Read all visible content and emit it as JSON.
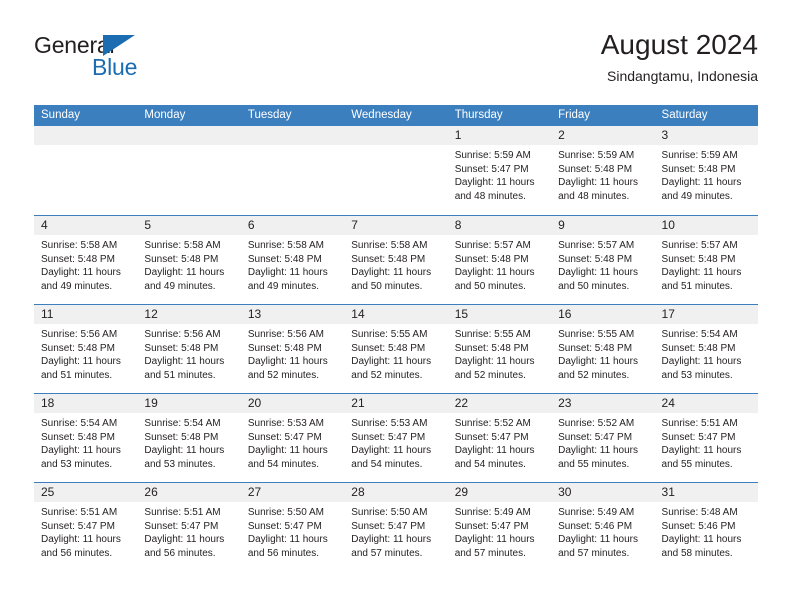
{
  "brand": {
    "name_top": "General",
    "name_bottom": "Blue",
    "accent_color": "#1b6cb0"
  },
  "header": {
    "title": "August 2024",
    "subtitle": "Sindangtamu, Indonesia"
  },
  "theme": {
    "header_row_bg": "#3c7fbf",
    "day_number_bg": "#f0f0f0",
    "text_color": "#231f20"
  },
  "weekdays": [
    "Sunday",
    "Monday",
    "Tuesday",
    "Wednesday",
    "Thursday",
    "Friday",
    "Saturday"
  ],
  "weeks": [
    [
      {
        "day": "",
        "lines": []
      },
      {
        "day": "",
        "lines": []
      },
      {
        "day": "",
        "lines": []
      },
      {
        "day": "",
        "lines": []
      },
      {
        "day": "1",
        "lines": [
          "Sunrise: 5:59 AM",
          "Sunset: 5:47 PM",
          "Daylight: 11 hours and 48 minutes."
        ]
      },
      {
        "day": "2",
        "lines": [
          "Sunrise: 5:59 AM",
          "Sunset: 5:48 PM",
          "Daylight: 11 hours and 48 minutes."
        ]
      },
      {
        "day": "3",
        "lines": [
          "Sunrise: 5:59 AM",
          "Sunset: 5:48 PM",
          "Daylight: 11 hours and 49 minutes."
        ]
      }
    ],
    [
      {
        "day": "4",
        "lines": [
          "Sunrise: 5:58 AM",
          "Sunset: 5:48 PM",
          "Daylight: 11 hours and 49 minutes."
        ]
      },
      {
        "day": "5",
        "lines": [
          "Sunrise: 5:58 AM",
          "Sunset: 5:48 PM",
          "Daylight: 11 hours and 49 minutes."
        ]
      },
      {
        "day": "6",
        "lines": [
          "Sunrise: 5:58 AM",
          "Sunset: 5:48 PM",
          "Daylight: 11 hours and 49 minutes."
        ]
      },
      {
        "day": "7",
        "lines": [
          "Sunrise: 5:58 AM",
          "Sunset: 5:48 PM",
          "Daylight: 11 hours and 50 minutes."
        ]
      },
      {
        "day": "8",
        "lines": [
          "Sunrise: 5:57 AM",
          "Sunset: 5:48 PM",
          "Daylight: 11 hours and 50 minutes."
        ]
      },
      {
        "day": "9",
        "lines": [
          "Sunrise: 5:57 AM",
          "Sunset: 5:48 PM",
          "Daylight: 11 hours and 50 minutes."
        ]
      },
      {
        "day": "10",
        "lines": [
          "Sunrise: 5:57 AM",
          "Sunset: 5:48 PM",
          "Daylight: 11 hours and 51 minutes."
        ]
      }
    ],
    [
      {
        "day": "11",
        "lines": [
          "Sunrise: 5:56 AM",
          "Sunset: 5:48 PM",
          "Daylight: 11 hours and 51 minutes."
        ]
      },
      {
        "day": "12",
        "lines": [
          "Sunrise: 5:56 AM",
          "Sunset: 5:48 PM",
          "Daylight: 11 hours and 51 minutes."
        ]
      },
      {
        "day": "13",
        "lines": [
          "Sunrise: 5:56 AM",
          "Sunset: 5:48 PM",
          "Daylight: 11 hours and 52 minutes."
        ]
      },
      {
        "day": "14",
        "lines": [
          "Sunrise: 5:55 AM",
          "Sunset: 5:48 PM",
          "Daylight: 11 hours and 52 minutes."
        ]
      },
      {
        "day": "15",
        "lines": [
          "Sunrise: 5:55 AM",
          "Sunset: 5:48 PM",
          "Daylight: 11 hours and 52 minutes."
        ]
      },
      {
        "day": "16",
        "lines": [
          "Sunrise: 5:55 AM",
          "Sunset: 5:48 PM",
          "Daylight: 11 hours and 52 minutes."
        ]
      },
      {
        "day": "17",
        "lines": [
          "Sunrise: 5:54 AM",
          "Sunset: 5:48 PM",
          "Daylight: 11 hours and 53 minutes."
        ]
      }
    ],
    [
      {
        "day": "18",
        "lines": [
          "Sunrise: 5:54 AM",
          "Sunset: 5:48 PM",
          "Daylight: 11 hours and 53 minutes."
        ]
      },
      {
        "day": "19",
        "lines": [
          "Sunrise: 5:54 AM",
          "Sunset: 5:48 PM",
          "Daylight: 11 hours and 53 minutes."
        ]
      },
      {
        "day": "20",
        "lines": [
          "Sunrise: 5:53 AM",
          "Sunset: 5:47 PM",
          "Daylight: 11 hours and 54 minutes."
        ]
      },
      {
        "day": "21",
        "lines": [
          "Sunrise: 5:53 AM",
          "Sunset: 5:47 PM",
          "Daylight: 11 hours and 54 minutes."
        ]
      },
      {
        "day": "22",
        "lines": [
          "Sunrise: 5:52 AM",
          "Sunset: 5:47 PM",
          "Daylight: 11 hours and 54 minutes."
        ]
      },
      {
        "day": "23",
        "lines": [
          "Sunrise: 5:52 AM",
          "Sunset: 5:47 PM",
          "Daylight: 11 hours and 55 minutes."
        ]
      },
      {
        "day": "24",
        "lines": [
          "Sunrise: 5:51 AM",
          "Sunset: 5:47 PM",
          "Daylight: 11 hours and 55 minutes."
        ]
      }
    ],
    [
      {
        "day": "25",
        "lines": [
          "Sunrise: 5:51 AM",
          "Sunset: 5:47 PM",
          "Daylight: 11 hours and 56 minutes."
        ]
      },
      {
        "day": "26",
        "lines": [
          "Sunrise: 5:51 AM",
          "Sunset: 5:47 PM",
          "Daylight: 11 hours and 56 minutes."
        ]
      },
      {
        "day": "27",
        "lines": [
          "Sunrise: 5:50 AM",
          "Sunset: 5:47 PM",
          "Daylight: 11 hours and 56 minutes."
        ]
      },
      {
        "day": "28",
        "lines": [
          "Sunrise: 5:50 AM",
          "Sunset: 5:47 PM",
          "Daylight: 11 hours and 57 minutes."
        ]
      },
      {
        "day": "29",
        "lines": [
          "Sunrise: 5:49 AM",
          "Sunset: 5:47 PM",
          "Daylight: 11 hours and 57 minutes."
        ]
      },
      {
        "day": "30",
        "lines": [
          "Sunrise: 5:49 AM",
          "Sunset: 5:46 PM",
          "Daylight: 11 hours and 57 minutes."
        ]
      },
      {
        "day": "31",
        "lines": [
          "Sunrise: 5:48 AM",
          "Sunset: 5:46 PM",
          "Daylight: 11 hours and 58 minutes."
        ]
      }
    ]
  ]
}
